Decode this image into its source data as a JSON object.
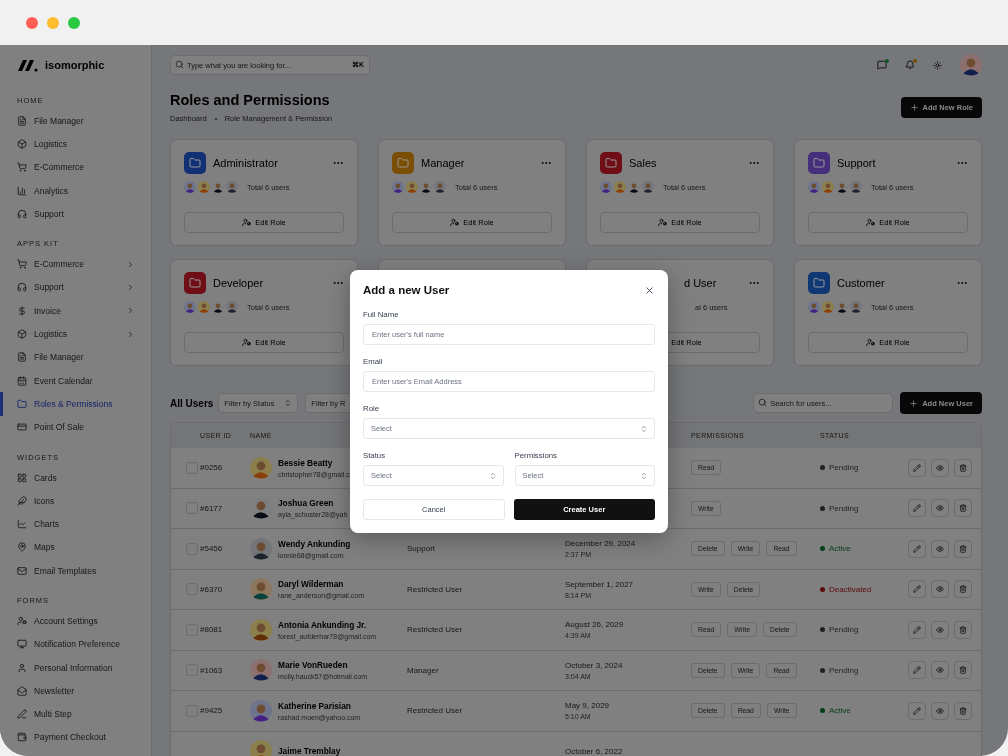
{
  "window": {
    "controls": [
      {
        "color": "#ff5f57"
      },
      {
        "color": "#febc2e"
      },
      {
        "color": "#28c840"
      }
    ]
  },
  "sidebar": {
    "logo": "isomorphic",
    "sections": [
      {
        "label": "HOME",
        "items": [
          {
            "label": "File Manager",
            "selected": false,
            "submenu": false
          },
          {
            "label": "Logistics",
            "selected": false,
            "submenu": false
          },
          {
            "label": "E-Commerce",
            "selected": false,
            "submenu": false
          },
          {
            "label": "Analytics",
            "selected": false,
            "submenu": false
          },
          {
            "label": "Support",
            "selected": false,
            "submenu": false
          }
        ]
      },
      {
        "label": "APPS KIT",
        "items": [
          {
            "label": "E-Commerce",
            "selected": false,
            "submenu": true
          },
          {
            "label": "Support",
            "selected": false,
            "submenu": true
          },
          {
            "label": "Invoice",
            "selected": false,
            "submenu": true
          },
          {
            "label": "Logistics",
            "selected": false,
            "submenu": true
          },
          {
            "label": "File Manager",
            "selected": false,
            "submenu": false
          },
          {
            "label": "Event Calendar",
            "selected": false,
            "submenu": false
          },
          {
            "label": "Roles & Permissions",
            "selected": true,
            "submenu": false
          },
          {
            "label": "Point Of Sale",
            "selected": false,
            "submenu": false
          }
        ]
      },
      {
        "label": "WIDGETS",
        "items": [
          {
            "label": "Cards",
            "selected": false,
            "submenu": false
          },
          {
            "label": "Icons",
            "selected": false,
            "submenu": false
          },
          {
            "label": "Charts",
            "selected": false,
            "submenu": false
          },
          {
            "label": "Maps",
            "selected": false,
            "submenu": false
          },
          {
            "label": "Email Templates",
            "selected": false,
            "submenu": false
          }
        ]
      },
      {
        "label": "FORMS",
        "items": [
          {
            "label": "Account Settings",
            "selected": false,
            "submenu": false
          },
          {
            "label": "Notification Preference",
            "selected": false,
            "submenu": false
          },
          {
            "label": "Personal Information",
            "selected": false,
            "submenu": false
          },
          {
            "label": "Newsletter",
            "selected": false,
            "submenu": false
          },
          {
            "label": "Multi Step",
            "selected": false,
            "submenu": false
          },
          {
            "label": "Payment Checkout",
            "selected": false,
            "submenu": false
          }
        ]
      }
    ]
  },
  "header": {
    "search": {
      "placeholder": "Type what you are looking for...",
      "shortcut": "⌘K"
    }
  },
  "page": {
    "title": "Roles and Permissions",
    "breadcrumbs": [
      "Dashboard",
      "Role Management & Permission"
    ],
    "add_button": "Add New Role"
  },
  "roles": [
    {
      "kind": "full",
      "title": "Administrator",
      "color": "#123175",
      "users_text": "Total 6 users",
      "button": "Edit Role"
    },
    {
      "kind": "full",
      "title": "Manager",
      "color": "#7a4f05",
      "users_text": "Total 6 users",
      "button": "Edit Role"
    },
    {
      "kind": "full",
      "title": "Sales",
      "color": "#700e17",
      "users_text": "Total 6 users",
      "button": "Edit Role"
    },
    {
      "kind": "full",
      "title": "Support",
      "color": "#452e7b",
      "users_text": "Total 6 users",
      "button": "Edit Role"
    },
    {
      "kind": "full",
      "title": "Developer",
      "color": "#700e17",
      "users_text": "Total 6 users",
      "button": "Edit Role"
    },
    {
      "kind": "covered"
    },
    {
      "kind": "partial",
      "title": "d User",
      "users_text": "al 6 users",
      "button": "Edit Role"
    },
    {
      "kind": "full",
      "title": "Customer",
      "color": "#0e3774",
      "users_text": "Total 6 users",
      "button": "Edit Role"
    }
  ],
  "users": {
    "title": "All Users",
    "filters": [
      {
        "kind": "full",
        "label": "Filter by Status"
      },
      {
        "kind": "partial",
        "label": "Filter by R"
      }
    ],
    "search": {
      "placeholder": "Search for users..."
    },
    "add_button": "Add New User",
    "columns": {
      "user_id": "USER ID",
      "name": "NAME",
      "permissions": "PERMISSIONS",
      "status": "STATUS"
    },
    "rows": [
      {
        "checked": false,
        "id": "#0256",
        "name": "Bessie Beatty",
        "email": "christopher78@gmail.c",
        "permissions": [
          "Read"
        ],
        "status": "Pending",
        "color": "#1f1f1f"
      },
      {
        "checked": false,
        "id": "#6177",
        "name": "Joshua Green",
        "email": "ayla_schuster28@yah",
        "permissions": [
          "Write"
        ],
        "status": "Pending",
        "color": "#1f1f1f"
      },
      {
        "checked": false,
        "id": "#5456",
        "name": "Wendy Ankunding",
        "email": "lonnie68@gmail.com",
        "role": "Support",
        "date": "December 29, 2024",
        "time": "2:37 PM",
        "permissions": [
          "Delete",
          "Write",
          "Read"
        ],
        "status": "Active",
        "color": "#053d18"
      },
      {
        "checked": false,
        "id": "#6370",
        "name": "Daryl Wilderman",
        "email": "rane_anderson@gmail.com",
        "role": "Restricted User",
        "date": "September 1, 2027",
        "time": "8:14 PM",
        "permissions": [
          "Write",
          "Delete"
        ],
        "status": "Deactivated",
        "color": "#5c0808"
      },
      {
        "checked": false,
        "id": "#8081",
        "name": "Antonia Ankunding Jr.",
        "email": "forest_aufderhar78@gmail.com",
        "role": "Restricted User",
        "date": "August 26, 2029",
        "time": "4:39 AM",
        "permissions": [
          "Read",
          "Write",
          "Delete"
        ],
        "status": "Pending",
        "color": "#1f1f1f"
      },
      {
        "checked": false,
        "id": "#1063",
        "name": "Marie VonRueden",
        "email": "molly.hauck57@hotmail.com",
        "role": "Manager",
        "date": "October 3, 2024",
        "time": "3:04 AM",
        "permissions": [
          "Delete",
          "Write",
          "Read"
        ],
        "status": "Pending",
        "color": "#1f1f1f"
      },
      {
        "checked": false,
        "id": "#9425",
        "name": "Katherine Parisian",
        "email": "rashad.moen@yahoo.com",
        "role": "Restricted User",
        "date": "May 9, 2029",
        "time": "5:10 AM",
        "permissions": [
          "Delete",
          "Read",
          "Write"
        ],
        "status": "Active",
        "color": "#053d18"
      },
      {
        "name": "Jaime Tremblay",
        "date": "October 6, 2022"
      }
    ]
  },
  "modal": {
    "title": "Add a new User",
    "fields": [
      {
        "kind": "input",
        "label": "Full Name",
        "placeholder": "Enter user's full name"
      },
      {
        "kind": "input",
        "label": "Email",
        "placeholder": "Enter user's Email Address"
      },
      {
        "kind": "select",
        "label": "Role",
        "value": "Select"
      },
      {
        "kind": "select",
        "label": "Status",
        "value": "Select",
        "half": true
      },
      {
        "kind": "select",
        "label": "Permissions",
        "value": "Select",
        "half": true
      }
    ],
    "cancel": "Cancel",
    "submit": "Create User"
  }
}
